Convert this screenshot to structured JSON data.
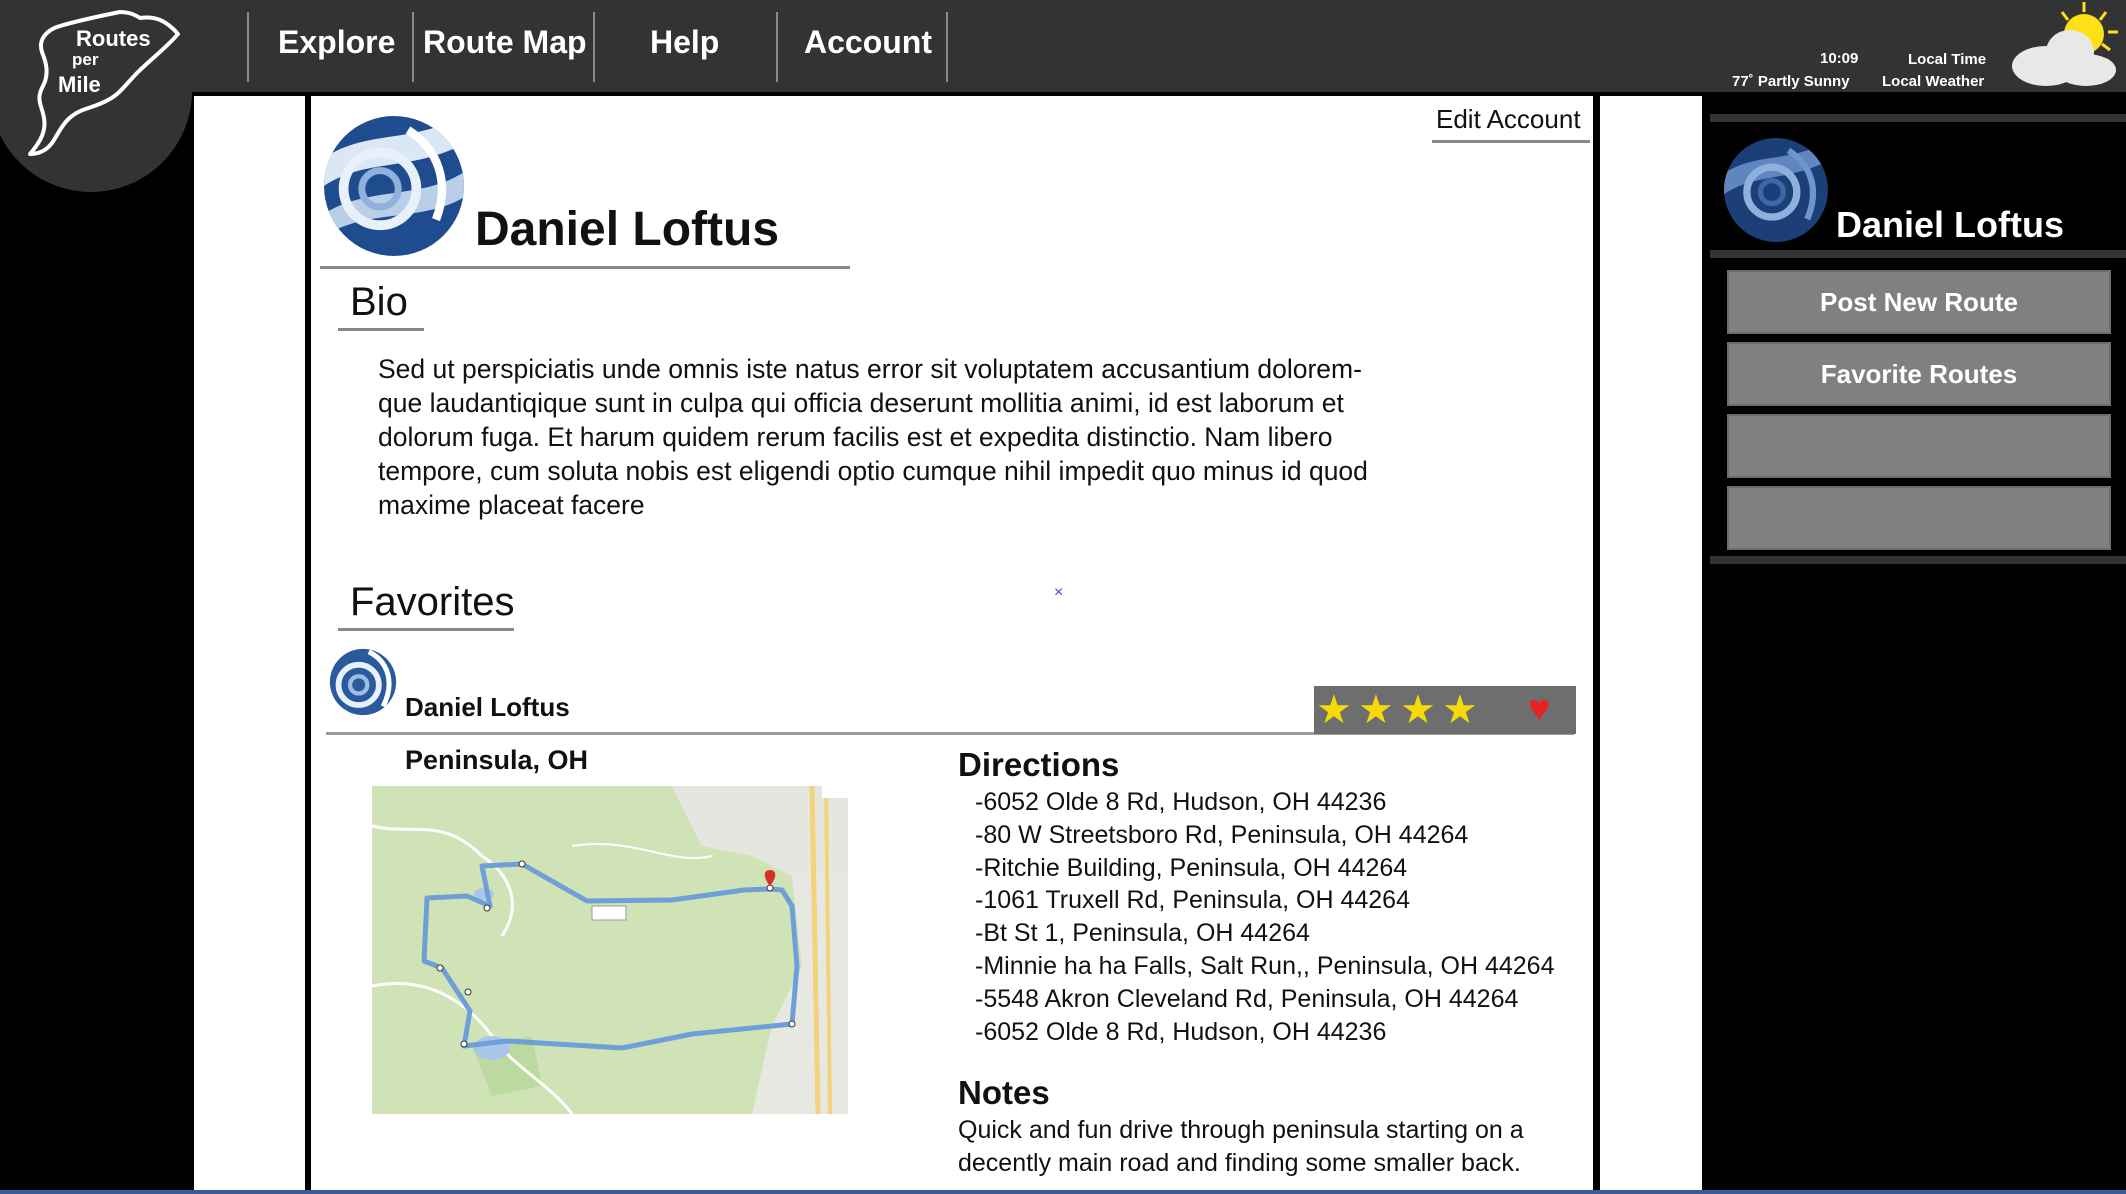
{
  "logo": {
    "line1": "Routes",
    "line2": "per",
    "line3": "Mile"
  },
  "nav": {
    "items": [
      "Explore",
      "Route Map",
      "Help",
      "Account"
    ]
  },
  "header": {
    "time": "10:09",
    "time_label": "Local Time",
    "weather": "77˚ Partly Sunny",
    "weather_label": "Local Weather"
  },
  "profile": {
    "edit_label": "Edit Account",
    "name": "Daniel Loftus",
    "bio_heading": "Bio",
    "bio": "Sed ut perspiciatis unde omnis iste natus error sit voluptatem accusantium dolorem-que laudantiqique sunt in culpa qui officia deserunt mollitia animi, id est laborum et dolorum fuga. Et harum quidem rerum facilis est et expedita distinctio. Nam libero tempore, cum soluta nobis est eligendi optio cumque nihil impedit quo minus id quod maxime placeat facere",
    "x_mark": "×",
    "favorites_heading": "Favorites"
  },
  "favorite_route": {
    "user": "Daniel Loftus",
    "location": "Peninsula, OH",
    "rating": 4,
    "rating_max": 4,
    "favorited": true,
    "directions_heading": "Directions",
    "directions": [
      "-6052 Olde 8 Rd, Hudson, OH 44236",
      "-80 W Streetsboro Rd, Peninsula, OH 44264",
      "-Ritchie Building, Peninsula, OH 44264",
      "-1061 Truxell Rd, Peninsula, OH 44264",
      "-Bt St 1, Peninsula, OH 44264",
      "-Minnie ha ha Falls, Salt Run,, Peninsula, OH 44264",
      "-5548 Akron Cleveland Rd, Peninsula, OH 44264",
      "-6052 Olde 8 Rd, Hudson, OH 44236"
    ],
    "notes_heading": "Notes",
    "notes": "Quick and fun drive through peninsula starting on a decently main road and finding some smaller back."
  },
  "sidebar": {
    "name": "Daniel Loftus",
    "buttons": [
      "Post New Route",
      "Favorite Routes",
      "",
      ""
    ]
  },
  "colors": {
    "nav_bg": "#333333",
    "button_gray": "#808080",
    "heart": "#e82222",
    "star": "#f5d90a",
    "route_line": "#6f9fd8"
  }
}
